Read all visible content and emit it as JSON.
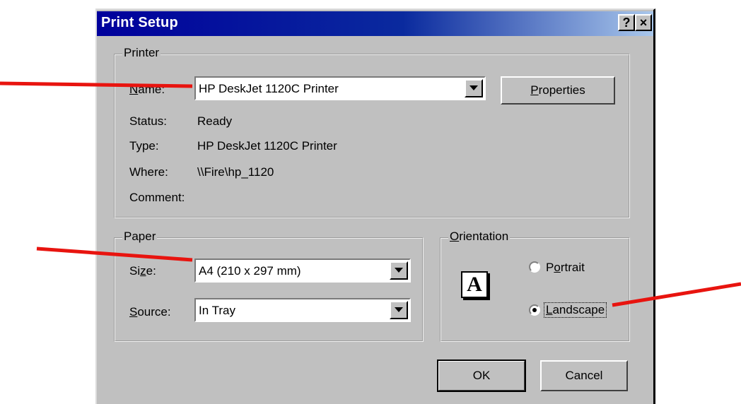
{
  "dialog": {
    "title": "Print Setup",
    "help_glyph": "?",
    "close_glyph": "×"
  },
  "printer": {
    "group_label": "Printer",
    "name_label": "Name:",
    "name_value": "HP DeskJet 1120C Printer",
    "properties_label": "Properties",
    "status_label": "Status:",
    "status_value": "Ready",
    "type_label": "Type:",
    "type_value": "HP DeskJet 1120C Printer",
    "where_label": "Where:",
    "where_value": "\\\\Fire\\hp_1120",
    "comment_label": "Comment:",
    "comment_value": ""
  },
  "paper": {
    "group_label": "Paper",
    "size_label": "Size:",
    "size_value": "A4 (210 x 297 mm)",
    "source_label": "Source:",
    "source_value": "In Tray"
  },
  "orientation": {
    "group_label": "Orientation",
    "icon_letter": "A",
    "portrait_label": "Portrait",
    "landscape_label": "Landscape",
    "selected": "Landscape"
  },
  "buttons": {
    "ok_label": "OK",
    "cancel_label": "Cancel"
  },
  "annotations": {
    "arrow_color": "#e8140f"
  }
}
